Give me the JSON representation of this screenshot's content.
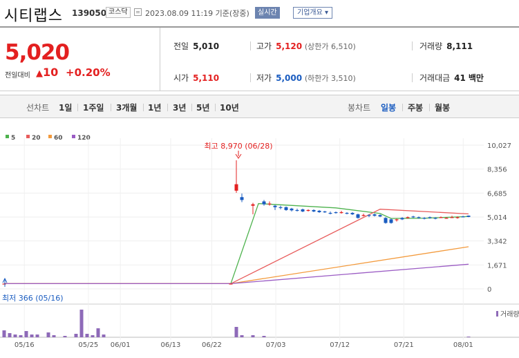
{
  "header": {
    "name": "시티랩스",
    "code": "139050",
    "market": "코스닥",
    "time": "2023.08.09 11:19 기준(장중)",
    "realtime": "실시간",
    "corp_info": "기업개요 ▾"
  },
  "quote": {
    "price": "5,020",
    "change_label": "전일대비",
    "change": "10",
    "change_pct": "+0.20%",
    "prev_label": "전일",
    "prev": "5,010",
    "high_label": "고가",
    "high": "5,120",
    "upper": "(상한가 6,510)",
    "volume_label": "거래량",
    "volume": "8,111",
    "open_label": "시가",
    "open": "5,110",
    "low_label": "저가",
    "low": "5,000",
    "lower": "(하한가 3,510)",
    "amount_label": "거래대금",
    "amount": "41",
    "amount_unit": "백만"
  },
  "tabs": {
    "line_label": "선차트",
    "periods": [
      "1일",
      "1주일",
      "3개월",
      "1년",
      "3년",
      "5년",
      "10년"
    ],
    "candle_label": "봉차트",
    "candles": [
      "일봉",
      "주봉",
      "월봉"
    ]
  },
  "colors": {
    "up": "#e32020",
    "down": "#1a5cc0"
  },
  "chart_data": {
    "type": "line",
    "legend": [
      {
        "name": "5",
        "color": "#4db24d"
      },
      {
        "name": "20",
        "color": "#e85c5c"
      },
      {
        "name": "60",
        "color": "#f39a3c"
      },
      {
        "name": "120",
        "color": "#9b5cc4"
      }
    ],
    "y_ticks": [
      "10,027",
      "8,356",
      "6,685",
      "5,014",
      "3,342",
      "1,671",
      "0"
    ],
    "ylim": [
      0,
      10027
    ],
    "x_ticks": [
      "05/16",
      "05/25",
      "06/01",
      "06/13",
      "06/22",
      "07/03",
      "07/12",
      "07/21",
      "08/01"
    ],
    "max_annotation": "최고 8,970 (06/28)",
    "min_annotation": "최저 366 (05/16)",
    "volume_label": "거래량",
    "ma_lines": [
      {
        "name": "5",
        "points": [
          [
            0,
            366
          ],
          [
            41,
            366
          ],
          [
            46,
            5950
          ],
          [
            60,
            5650
          ],
          [
            68,
            5260
          ],
          [
            70,
            4910
          ],
          [
            76,
            4930
          ],
          [
            84,
            5050
          ]
        ]
      },
      {
        "name": "20",
        "points": [
          [
            0,
            366
          ],
          [
            41,
            366
          ],
          [
            68,
            5560
          ],
          [
            84,
            5230
          ]
        ]
      },
      {
        "name": "60",
        "points": [
          [
            0,
            366
          ],
          [
            41,
            366
          ],
          [
            84,
            2940
          ]
        ]
      },
      {
        "name": "120",
        "points": [
          [
            0,
            366
          ],
          [
            41,
            366
          ],
          [
            84,
            1720
          ]
        ]
      }
    ],
    "candles": [
      {
        "i": 0,
        "o": 366,
        "c": 366,
        "h": 366,
        "l": 366
      },
      {
        "i": 41,
        "o": 366,
        "c": 366,
        "h": 366,
        "l": 366
      },
      {
        "i": 42,
        "o": 6850,
        "c": 7300,
        "h": 8970,
        "l": 6700
      },
      {
        "i": 43,
        "o": 6400,
        "c": 6200,
        "h": 6650,
        "l": 6050
      },
      {
        "i": 45,
        "o": 5800,
        "c": 5900,
        "h": 6000,
        "l": 5200
      },
      {
        "i": 47,
        "o": 6100,
        "c": 5900,
        "h": 6200,
        "l": 5800
      },
      {
        "i": 48,
        "o": 5900,
        "c": 5950,
        "h": 6100,
        "l": 5800
      },
      {
        "i": 49,
        "o": 5800,
        "c": 5700,
        "h": 5850,
        "l": 5500
      },
      {
        "i": 50,
        "o": 5700,
        "c": 5650,
        "h": 5800,
        "l": 5550
      },
      {
        "i": 51,
        "o": 5700,
        "c": 5500,
        "h": 5750,
        "l": 5450
      },
      {
        "i": 52,
        "o": 5600,
        "c": 5480,
        "h": 5650,
        "l": 5400
      },
      {
        "i": 53,
        "o": 5500,
        "c": 5450,
        "h": 5600,
        "l": 5400
      },
      {
        "i": 54,
        "o": 5550,
        "c": 5400,
        "h": 5600,
        "l": 5350
      },
      {
        "i": 55,
        "o": 5450,
        "c": 5500,
        "h": 5550,
        "l": 5400
      },
      {
        "i": 56,
        "o": 5500,
        "c": 5400,
        "h": 5550,
        "l": 5350
      },
      {
        "i": 57,
        "o": 5450,
        "c": 5350,
        "h": 5500,
        "l": 5300
      },
      {
        "i": 58,
        "o": 5400,
        "c": 5350,
        "h": 5450,
        "l": 5300
      },
      {
        "i": 59,
        "o": 5300,
        "c": 5250,
        "h": 5400,
        "l": 5200
      },
      {
        "i": 60,
        "o": 5350,
        "c": 5300,
        "h": 5400,
        "l": 5250
      },
      {
        "i": 61,
        "o": 5300,
        "c": 5350,
        "h": 5450,
        "l": 5250
      },
      {
        "i": 62,
        "o": 5300,
        "c": 5250,
        "h": 5350,
        "l": 5200
      },
      {
        "i": 63,
        "o": 5300,
        "c": 5200,
        "h": 5350,
        "l": 5150
      },
      {
        "i": 64,
        "o": 5200,
        "c": 4950,
        "h": 5250,
        "l": 4900
      },
      {
        "i": 65,
        "o": 5100,
        "c": 5150,
        "h": 5250,
        "l": 5050
      },
      {
        "i": 66,
        "o": 5150,
        "c": 5100,
        "h": 5200,
        "l": 5000
      },
      {
        "i": 67,
        "o": 5200,
        "c": 5100,
        "h": 5250,
        "l": 5050
      },
      {
        "i": 68,
        "o": 5150,
        "c": 5050,
        "h": 5200,
        "l": 5000
      },
      {
        "i": 69,
        "o": 4950,
        "c": 4600,
        "h": 5000,
        "l": 4550
      },
      {
        "i": 70,
        "o": 4850,
        "c": 4600,
        "h": 4900,
        "l": 4550
      },
      {
        "i": 71,
        "o": 4800,
        "c": 4850,
        "h": 4900,
        "l": 4700
      },
      {
        "i": 72,
        "o": 4950,
        "c": 4850,
        "h": 5000,
        "l": 4800
      },
      {
        "i": 73,
        "o": 4950,
        "c": 5000,
        "h": 5050,
        "l": 4900
      },
      {
        "i": 74,
        "o": 5050,
        "c": 5000,
        "h": 5100,
        "l": 4950
      },
      {
        "i": 75,
        "o": 5000,
        "c": 4950,
        "h": 5050,
        "l": 4900
      },
      {
        "i": 76,
        "o": 4950,
        "c": 4900,
        "h": 5000,
        "l": 4850
      },
      {
        "i": 77,
        "o": 5000,
        "c": 4950,
        "h": 5050,
        "l": 4900
      },
      {
        "i": 78,
        "o": 4950,
        "c": 4900,
        "h": 5000,
        "l": 4850
      },
      {
        "i": 79,
        "o": 5000,
        "c": 5000,
        "h": 5050,
        "l": 4950
      },
      {
        "i": 80,
        "o": 4950,
        "c": 4950,
        "h": 5000,
        "l": 4900
      },
      {
        "i": 81,
        "o": 5000,
        "c": 5000,
        "h": 5100,
        "l": 4950
      },
      {
        "i": 82,
        "o": 4950,
        "c": 5000,
        "h": 5050,
        "l": 4900
      },
      {
        "i": 83,
        "o": 5050,
        "c": 5020,
        "h": 5100,
        "l": 5000
      },
      {
        "i": 84,
        "o": 5110,
        "c": 5020,
        "h": 5120,
        "l": 5000
      }
    ],
    "volume": [
      {
        "i": 0,
        "v": 1.0
      },
      {
        "i": 1,
        "v": 0.6
      },
      {
        "i": 2,
        "v": 0.4
      },
      {
        "i": 3,
        "v": 0.3
      },
      {
        "i": 4,
        "v": 0.9
      },
      {
        "i": 5,
        "v": 0.4
      },
      {
        "i": 6,
        "v": 0.4
      },
      {
        "i": 8,
        "v": 0.7
      },
      {
        "i": 9,
        "v": 0.3
      },
      {
        "i": 11,
        "v": 0.2
      },
      {
        "i": 13,
        "v": 0.5
      },
      {
        "i": 14,
        "v": 4.0
      },
      {
        "i": 15,
        "v": 0.5
      },
      {
        "i": 16,
        "v": 0.3
      },
      {
        "i": 17,
        "v": 1.3
      },
      {
        "i": 18,
        "v": 0.4
      },
      {
        "i": 42,
        "v": 1.5
      },
      {
        "i": 43,
        "v": 0.3
      },
      {
        "i": 45,
        "v": 0.3
      },
      {
        "i": 47,
        "v": 0.2
      },
      {
        "i": 84,
        "v": 0.1
      }
    ]
  }
}
